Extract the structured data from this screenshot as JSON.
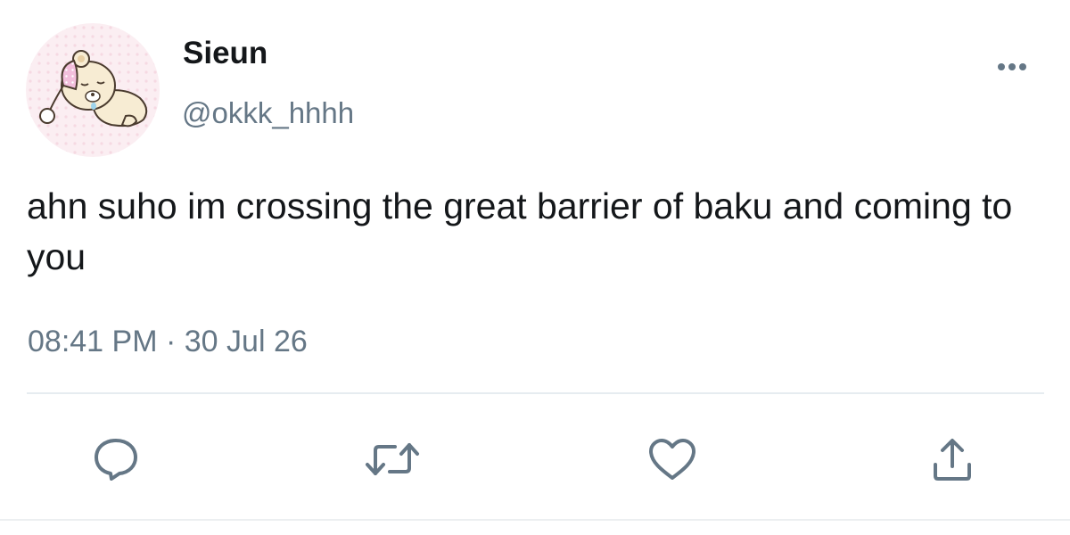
{
  "user": {
    "display_name": "Sieun",
    "handle": "@okkk_hhhh",
    "avatar_icon": "sleeping-bear-avatar"
  },
  "tweet": {
    "text": "ahn suho im crossing the great barrier of baku and coming to you",
    "time": "08:41 PM",
    "separator": "·",
    "date": "30 Jul 26"
  },
  "actions": [
    {
      "name": "reply",
      "icon": "reply-icon"
    },
    {
      "name": "retweet",
      "icon": "retweet-icon"
    },
    {
      "name": "like",
      "icon": "heart-icon"
    },
    {
      "name": "share",
      "icon": "share-icon"
    }
  ],
  "colors": {
    "text_primary": "#14171a",
    "text_secondary": "#657786",
    "icon": "#657786",
    "divider": "#e6ecf0"
  }
}
